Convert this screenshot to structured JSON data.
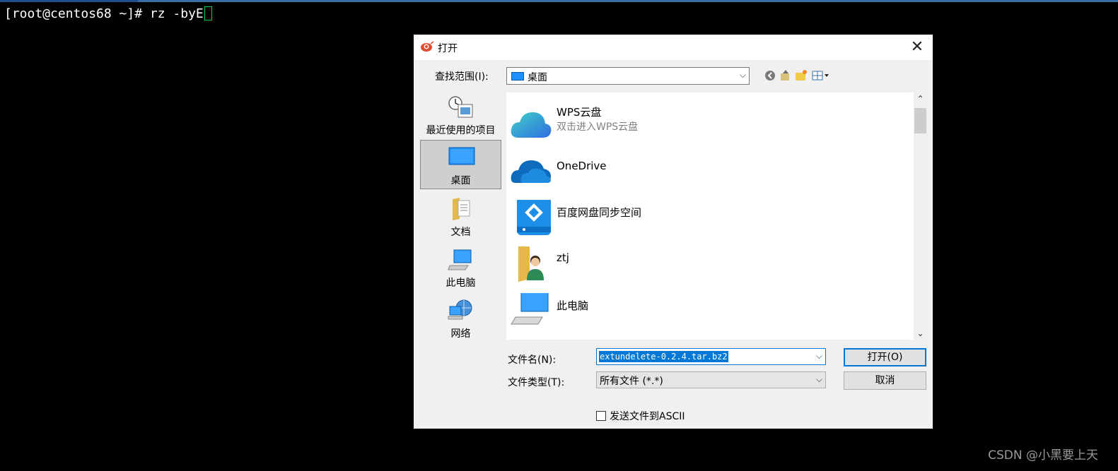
{
  "terminal": {
    "prompt": "[root@centos68 ~]# rz -byE"
  },
  "dialog": {
    "title": "打开",
    "close_glyph": "✕",
    "look_in_label": "查找范围(I):",
    "look_in_value": "桌面",
    "toolbar_icons": [
      "back-icon",
      "up-folder-icon",
      "new-folder-icon",
      "view-menu-icon"
    ],
    "places": [
      {
        "label": "最近使用的项目",
        "icon": "recent-items-icon"
      },
      {
        "label": "桌面",
        "icon": "desktop-icon",
        "selected": true
      },
      {
        "label": "文档",
        "icon": "documents-icon"
      },
      {
        "label": "此电脑",
        "icon": "this-pc-icon"
      },
      {
        "label": "网络",
        "icon": "network-icon"
      }
    ],
    "files": [
      {
        "name": "WPS云盘",
        "sub": "双击进入WPS云盘",
        "icon": "wps-cloud-icon"
      },
      {
        "name": "OneDrive",
        "icon": "onedrive-icon"
      },
      {
        "name": "百度网盘同步空间",
        "icon": "baidu-netdisk-icon"
      },
      {
        "name": "ztj",
        "icon": "user-folder-icon"
      },
      {
        "name": "此电脑",
        "icon": "this-pc-icon"
      }
    ],
    "file_name_label": "文件名(N):",
    "file_name_value": "extundelete-0.2.4.tar.bz2",
    "file_type_label": "文件类型(T):",
    "file_type_value": "所有文件 (*.*)",
    "open_button": "打开(O)",
    "cancel_button": "取消",
    "ascii_checkbox_label": "发送文件到ASCII",
    "ascii_checked": false
  },
  "watermark": "CSDN @小黑要上天",
  "colors": {
    "accent": "#0078d7",
    "terminal_bg": "#000000",
    "cursor": "#00d24a"
  }
}
